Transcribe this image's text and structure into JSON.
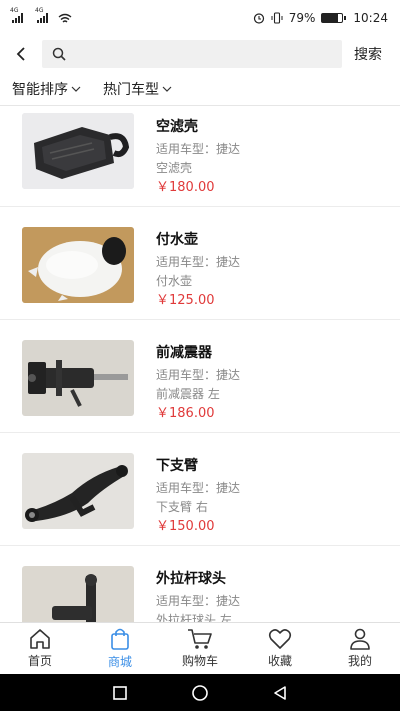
{
  "status": {
    "network1": "4G",
    "network2": "4G",
    "battery_text": "79%",
    "time": "10:24",
    "battery_level": 0.79
  },
  "search": {
    "placeholder": "",
    "button_label": "搜索"
  },
  "filters": [
    {
      "label": "智能排序"
    },
    {
      "label": "热门车型"
    }
  ],
  "products": [
    {
      "title": "空滤壳",
      "model": "适用车型：捷达",
      "desc": "空滤壳",
      "price": "￥180.00",
      "image_icon": "air-filter-housing"
    },
    {
      "title": "付水壶",
      "model": "适用车型：捷达",
      "desc": "付水壶",
      "price": "￥125.00",
      "image_icon": "coolant-reservoir"
    },
    {
      "title": "前减震器",
      "model": "适用车型：捷达",
      "desc": "前减震器 左",
      "price": "￥186.00",
      "image_icon": "shock-absorber"
    },
    {
      "title": "下支臂",
      "model": "适用车型：捷达",
      "desc": "下支臂 右",
      "price": "￥150.00",
      "image_icon": "control-arm"
    },
    {
      "title": "外拉杆球头",
      "model": "适用车型：捷达",
      "desc": "外拉杆球头 左",
      "price": "",
      "image_icon": "tie-rod-end"
    }
  ],
  "tabbar": [
    {
      "label": "首页",
      "icon": "home-icon"
    },
    {
      "label": "商城",
      "icon": "shopping-bag-icon"
    },
    {
      "label": "购物车",
      "icon": "cart-icon"
    },
    {
      "label": "收藏",
      "icon": "heart-icon"
    },
    {
      "label": "我的",
      "icon": "user-icon"
    }
  ],
  "colors": {
    "accent": "#3a8ee6",
    "price": "#e03a3a"
  }
}
